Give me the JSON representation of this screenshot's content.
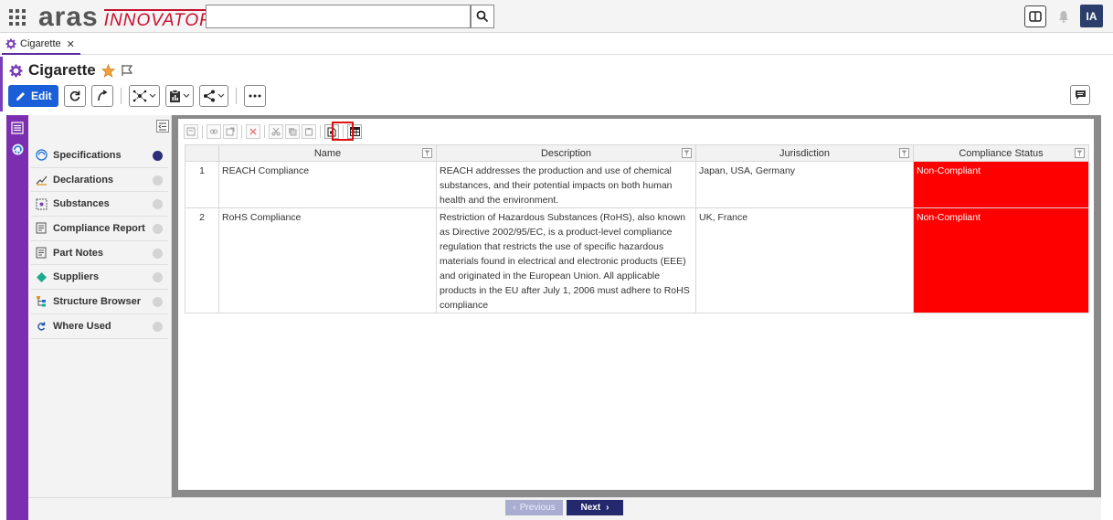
{
  "header": {
    "logo_main": "aras",
    "logo_sub": "INNOVATOR",
    "search_placeholder": "",
    "avatar_initials": "IA"
  },
  "tabs": [
    {
      "label": "Cigarette"
    }
  ],
  "item": {
    "title": "Cigarette",
    "edit_label": "Edit"
  },
  "sidebar": {
    "items": [
      {
        "label": "Specifications",
        "icon": "specifications-icon",
        "active": true
      },
      {
        "label": "Declarations",
        "icon": "declarations-icon",
        "active": false
      },
      {
        "label": "Substances",
        "icon": "substances-icon",
        "active": false
      },
      {
        "label": "Compliance Report",
        "icon": "report-icon",
        "active": false
      },
      {
        "label": "Part Notes",
        "icon": "notes-icon",
        "active": false
      },
      {
        "label": "Suppliers",
        "icon": "suppliers-icon",
        "active": false
      },
      {
        "label": "Structure Browser",
        "icon": "structure-icon",
        "active": false
      },
      {
        "label": "Where Used",
        "icon": "where-used-icon",
        "active": false
      }
    ]
  },
  "grid": {
    "columns": [
      "Name",
      "Description",
      "Jurisdiction",
      "Compliance Status"
    ],
    "rows": [
      {
        "num": "1",
        "name": "REACH Compliance",
        "description": "REACH addresses the production and use of chemical substances, and their potential impacts on both human health and the environment.",
        "jurisdiction": "Japan, USA, Germany",
        "status": "Non-Compliant"
      },
      {
        "num": "2",
        "name": "RoHS Compliance",
        "description": "Restriction of Hazardous Substances (RoHS), also known as Directive 2002/95/EC, is a product-level compliance regulation that restricts the use of specific hazardous materials found in electrical and electronic products (EEE) and originated in the European Union. All applicable products in the EU after July 1, 2006 must adhere to RoHS compliance",
        "jurisdiction": "UK, France",
        "status": "Non-Compliant"
      }
    ]
  },
  "pager": {
    "prev_label": "Previous",
    "next_label": "Next"
  },
  "colors": {
    "brand_purple": "#7b2fb0",
    "edit_blue": "#1b5fd8",
    "status_red": "#ff0000",
    "next_navy": "#24296e"
  }
}
